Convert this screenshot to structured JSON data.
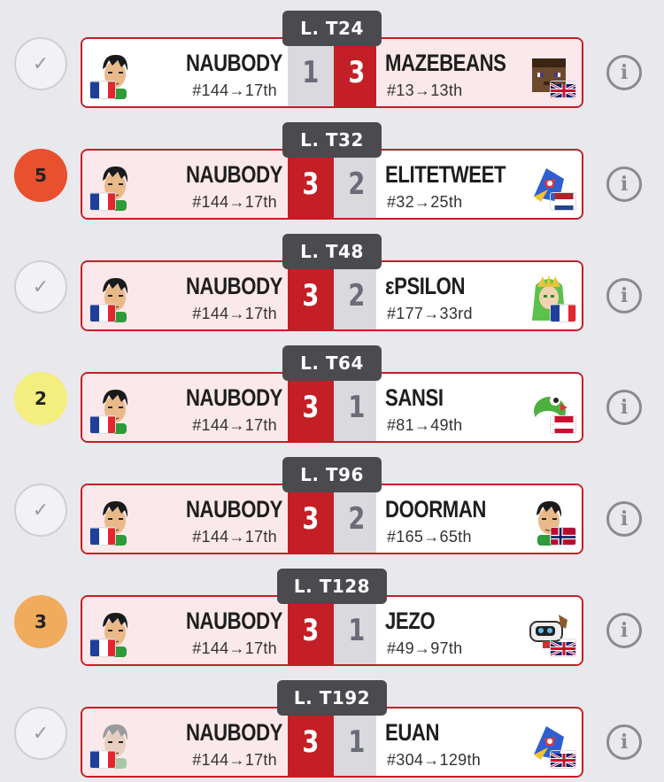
{
  "matches": [
    {
      "round": "L. T24",
      "badge": {
        "type": "check",
        "text": "✓",
        "color": "#f2f2f4"
      },
      "left": {
        "name": "NAUBODY",
        "seed": "#144→17th",
        "flag": "france",
        "avatar": "little-mac",
        "win": false
      },
      "score_left": "1",
      "score_right": "3",
      "right": {
        "name": "MAZEBEANS",
        "seed": "#13→13th",
        "flag": "uk",
        "avatar": "steve",
        "win": true
      }
    },
    {
      "round": "L. T32",
      "badge": {
        "type": "number",
        "text": "5",
        "color": "#e8502e"
      },
      "left": {
        "name": "NAUBODY",
        "seed": "#144→17th",
        "flag": "france",
        "avatar": "little-mac",
        "win": true
      },
      "score_left": "3",
      "score_right": "2",
      "right": {
        "name": "ELITETWEET",
        "seed": "#32→25th",
        "flag": "netherlands",
        "avatar": "falco",
        "win": false
      }
    },
    {
      "round": "L. T48",
      "badge": {
        "type": "check",
        "text": "✓",
        "color": "#f2f2f4"
      },
      "left": {
        "name": "NAUBODY",
        "seed": "#144→17th",
        "flag": "france",
        "avatar": "little-mac",
        "win": true
      },
      "score_left": "3",
      "score_right": "2",
      "right": {
        "name": "εPSILON",
        "seed": "#177→33rd",
        "flag": "france",
        "avatar": "palutena",
        "win": false
      }
    },
    {
      "round": "L. T64",
      "badge": {
        "type": "number",
        "text": "2",
        "color": "#f3ee7e"
      },
      "left": {
        "name": "NAUBODY",
        "seed": "#144→17th",
        "flag": "france",
        "avatar": "little-mac",
        "win": true
      },
      "score_left": "3",
      "score_right": "1",
      "right": {
        "name": "SANSI",
        "seed": "#81→49th",
        "flag": "austria",
        "avatar": "yoshi",
        "win": false
      }
    },
    {
      "round": "L. T96",
      "badge": {
        "type": "check",
        "text": "✓",
        "color": "#f2f2f4"
      },
      "left": {
        "name": "NAUBODY",
        "seed": "#144→17th",
        "flag": "france",
        "avatar": "little-mac",
        "win": true
      },
      "score_left": "3",
      "score_right": "2",
      "right": {
        "name": "DOORMAN",
        "seed": "#165→65th",
        "flag": "norway",
        "avatar": "little-mac",
        "win": false
      }
    },
    {
      "round": "L. T128",
      "badge": {
        "type": "number",
        "text": "3",
        "color": "#f0ab5c"
      },
      "left": {
        "name": "NAUBODY",
        "seed": "#144→17th",
        "flag": "france",
        "avatar": "little-mac",
        "win": true
      },
      "score_left": "3",
      "score_right": "1",
      "right": {
        "name": "JEZO",
        "seed": "#49→97th",
        "flag": "uk",
        "avatar": "rob",
        "win": false
      }
    },
    {
      "round": "L. T192",
      "badge": {
        "type": "check",
        "text": "✓",
        "color": "#f2f2f4"
      },
      "left": {
        "name": "NAUBODY",
        "seed": "#144→17th",
        "flag": "france",
        "avatar": "little-mac-alt",
        "win": true
      },
      "score_left": "3",
      "score_right": "1",
      "right": {
        "name": "EUAN",
        "seed": "#304→129th",
        "flag": "uk",
        "avatar": "falco",
        "win": false
      }
    }
  ],
  "info_icon": "i",
  "colors": {
    "win_red": "#c41e26",
    "win_bg": "#fbe8ea",
    "round_tab": "#4a4a4f"
  }
}
